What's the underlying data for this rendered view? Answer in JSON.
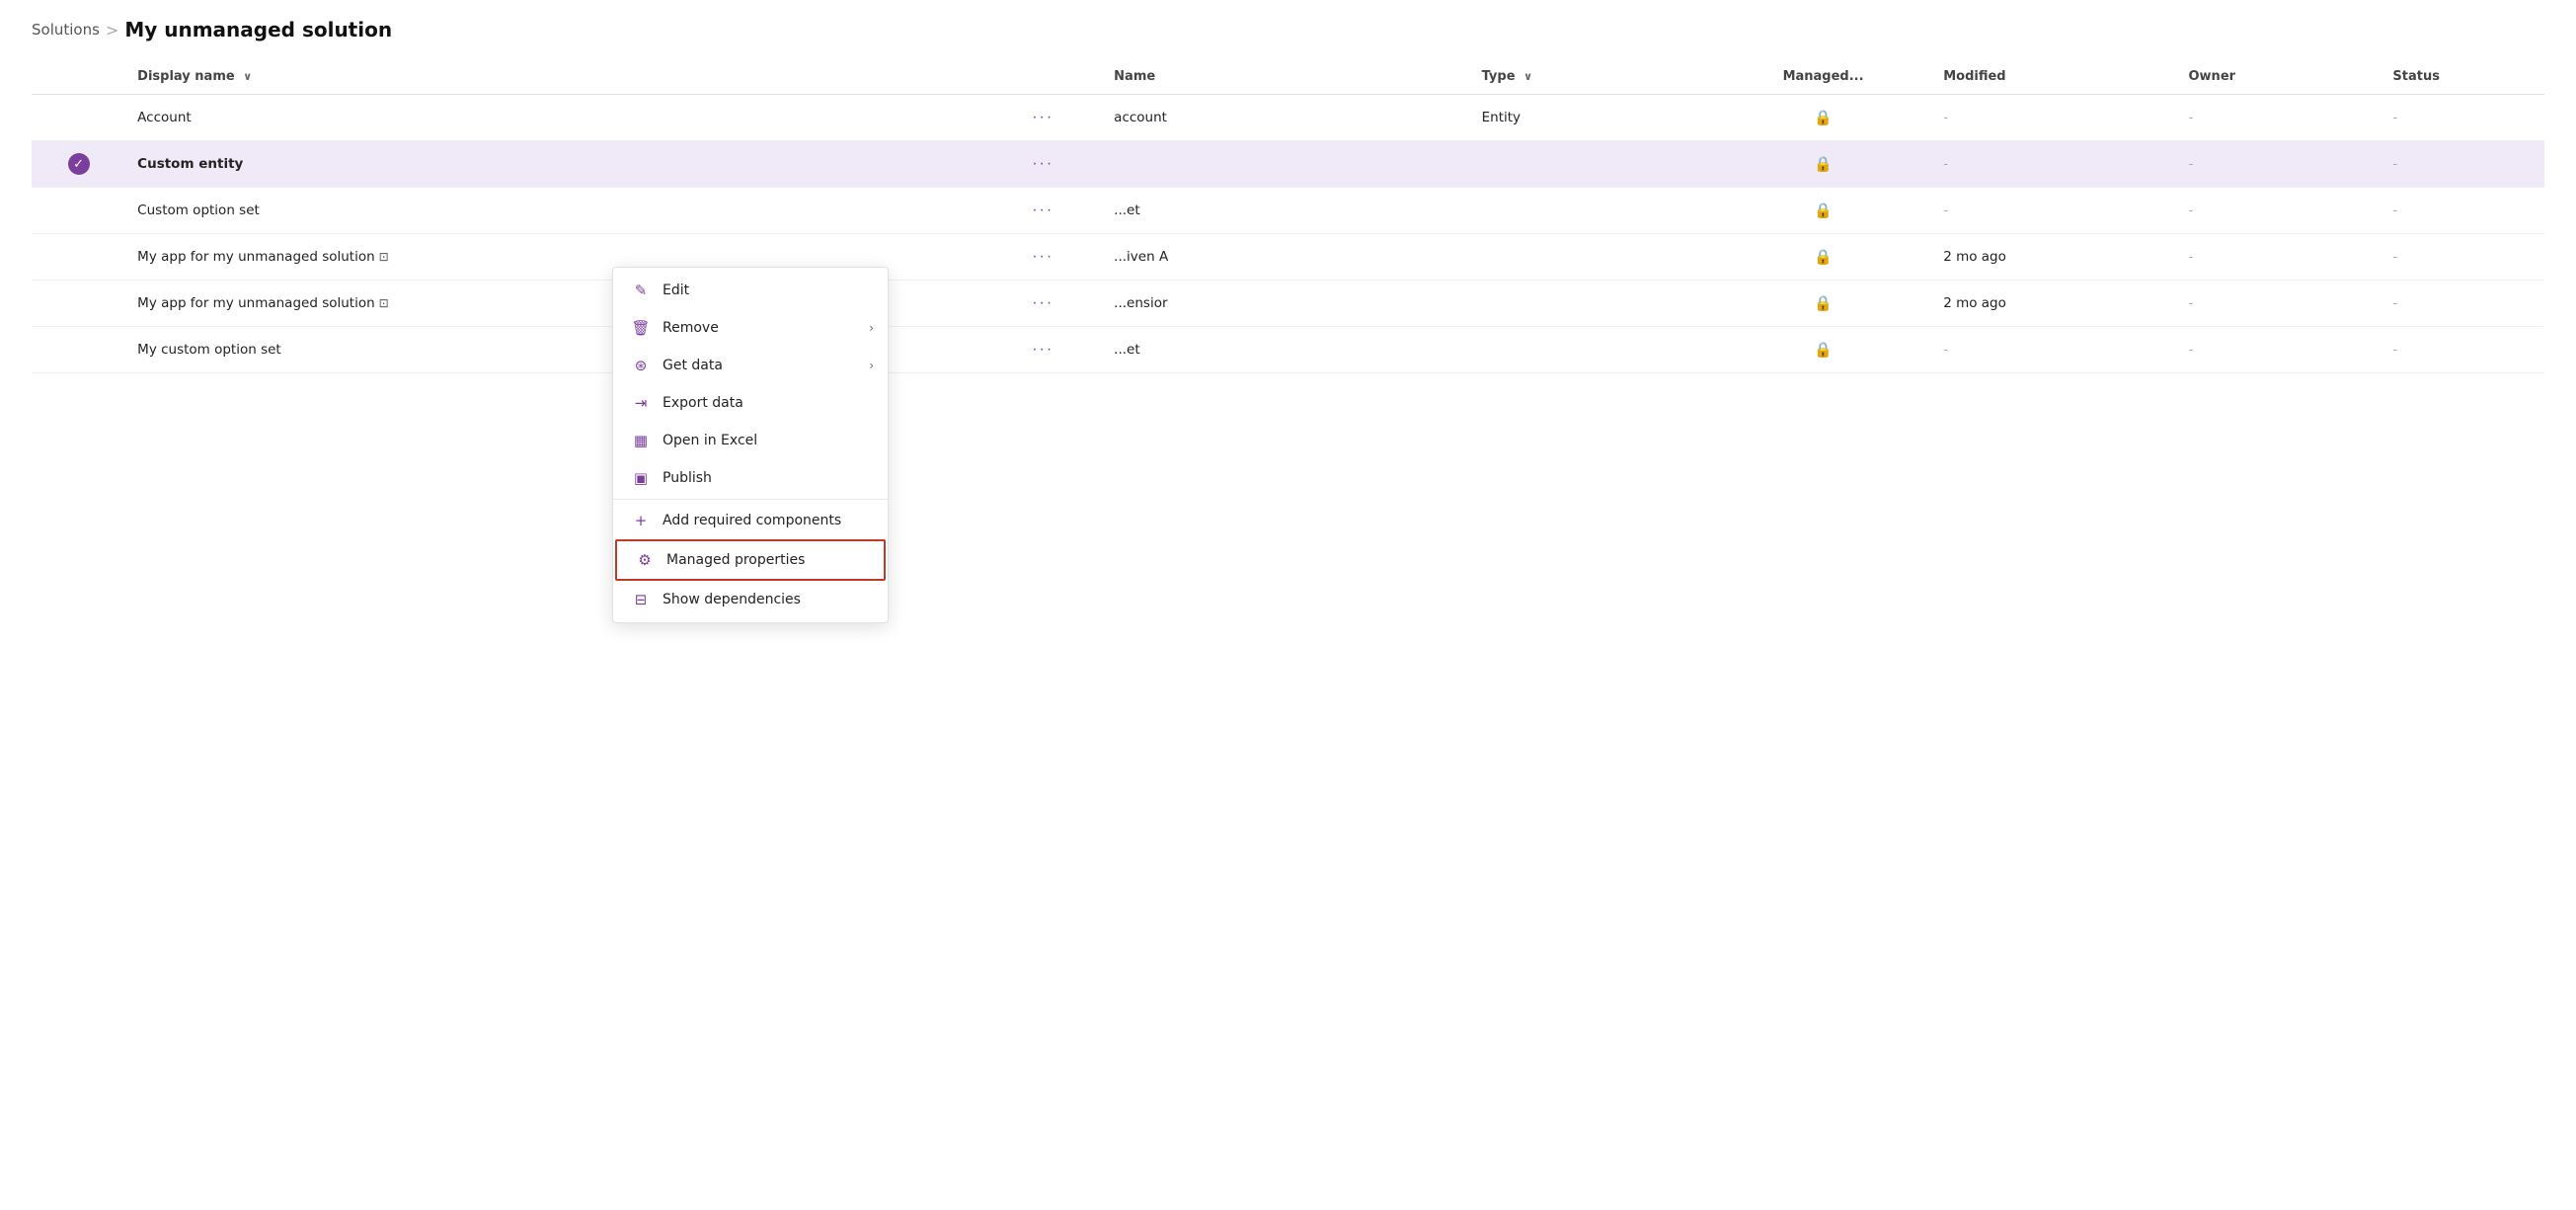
{
  "breadcrumb": {
    "parent": "Solutions",
    "separator": ">",
    "current": "My unmanaged solution"
  },
  "table": {
    "columns": [
      {
        "id": "check",
        "label": ""
      },
      {
        "id": "display_name",
        "label": "Display name",
        "sortable": true
      },
      {
        "id": "dots",
        "label": ""
      },
      {
        "id": "name",
        "label": "Name"
      },
      {
        "id": "type",
        "label": "Type",
        "sortable": true
      },
      {
        "id": "managed",
        "label": "Managed..."
      },
      {
        "id": "modified",
        "label": "Modified"
      },
      {
        "id": "owner",
        "label": "Owner"
      },
      {
        "id": "status",
        "label": "Status"
      }
    ],
    "rows": [
      {
        "id": "row-account",
        "selected": false,
        "display_name": "Account",
        "has_external": false,
        "name": "account",
        "type": "Entity",
        "managed": "lock",
        "modified": "-",
        "owner": "-",
        "status": "-"
      },
      {
        "id": "row-custom-entity",
        "selected": true,
        "display_name": "Custom entity",
        "has_external": false,
        "name": "",
        "type": "",
        "managed": "lock",
        "modified": "-",
        "owner": "-",
        "status": "-"
      },
      {
        "id": "row-custom-option-set",
        "selected": false,
        "display_name": "Custom option set",
        "has_external": false,
        "name": "...et",
        "type": "",
        "managed": "lock",
        "modified": "-",
        "owner": "-",
        "status": "-"
      },
      {
        "id": "row-app1",
        "selected": false,
        "display_name": "My app for my unmanaged solution",
        "has_external": true,
        "name": "...iven A",
        "type": "",
        "managed": "lock",
        "modified": "2 mo ago",
        "owner": "-",
        "status": "-"
      },
      {
        "id": "row-app2",
        "selected": false,
        "display_name": "My app for my unmanaged solution",
        "has_external": true,
        "name": "...ensior",
        "type": "",
        "managed": "lock",
        "modified": "2 mo ago",
        "owner": "-",
        "status": "-"
      },
      {
        "id": "row-custom-option-set2",
        "selected": false,
        "display_name": "My custom option set",
        "has_external": false,
        "name": "...et",
        "type": "",
        "managed": "lock",
        "modified": "-",
        "owner": "-",
        "status": "-"
      }
    ]
  },
  "context_menu": {
    "items": [
      {
        "id": "edit",
        "label": "Edit",
        "icon": "pencil",
        "has_submenu": false
      },
      {
        "id": "remove",
        "label": "Remove",
        "icon": "trash",
        "has_submenu": true
      },
      {
        "id": "get-data",
        "label": "Get data",
        "icon": "database",
        "has_submenu": true
      },
      {
        "id": "export-data",
        "label": "Export data",
        "icon": "arrow-right",
        "has_submenu": false
      },
      {
        "id": "open-excel",
        "label": "Open in Excel",
        "icon": "excel",
        "has_submenu": false
      },
      {
        "id": "publish",
        "label": "Publish",
        "icon": "screen",
        "has_submenu": false
      },
      {
        "id": "add-required",
        "label": "Add required components",
        "icon": "plus",
        "has_submenu": false
      },
      {
        "id": "managed-properties",
        "label": "Managed properties",
        "icon": "gear",
        "has_submenu": false,
        "highlighted": true
      },
      {
        "id": "show-dependencies",
        "label": "Show dependencies",
        "icon": "hierarchy",
        "has_submenu": false
      }
    ]
  }
}
